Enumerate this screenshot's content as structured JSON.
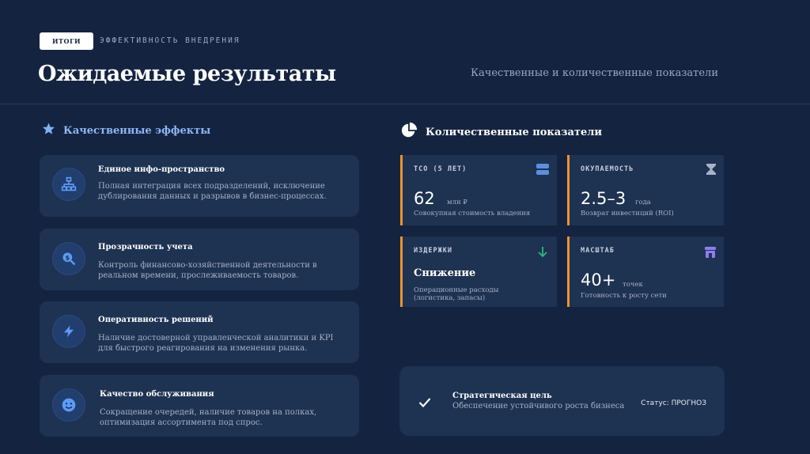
{
  "header": {
    "tag": "ИТОГИ",
    "eyebrow": "ЭФФЕКТИВНОСТЬ ВНЕДРЕНИЯ",
    "title": "Ожидаемые результаты",
    "subtitle": "Качественные и количественные показатели"
  },
  "qualitative": {
    "title": "Качественные эффекты",
    "icon": "star-icon",
    "items": [
      {
        "icon": "network-icon",
        "title": "Единое инфо-пространство",
        "text": "Полная интеграция всех подразделений, исключение дублирования данных и разрывов в бизнес-процессах."
      },
      {
        "icon": "search-dollar-icon",
        "title": "Прозрачность учета",
        "text": "Контроль финансово-хозяйственной деятельности в реальном времени, прослеживаемость товаров."
      },
      {
        "icon": "bolt-icon",
        "title": "Оперативность решений",
        "text": "Наличие достоверной управленческой аналитики и KPI для быстрого реагирования на изменения рынка."
      },
      {
        "icon": "smile-icon",
        "title": "Качество обслуживания",
        "text": "Сокращение очередей, наличие товаров на полках, оптимизация ассортимента под спрос."
      }
    ]
  },
  "quantitative": {
    "title": "Количественные показатели",
    "icon": "pie-chart-icon",
    "metrics": [
      {
        "label": "TCO (5 ЛЕТ)",
        "value": "62",
        "unit": "млн ₽",
        "sub": "Совокупная стоимость владения",
        "icon": "server-icon",
        "icon_color": "#5b8fe0"
      },
      {
        "label": "ОКУПАЕМОСТЬ",
        "value": "2.5–3",
        "unit": "года",
        "sub": "Возврат инвестиций (ROI)",
        "icon": "hourglass-icon",
        "icon_color": "#a8b4c6"
      },
      {
        "label": "ИЗДЕРЖКИ",
        "value": "Снижение",
        "unit": "",
        "sub": "Операционные расходы (логистика, запасы)",
        "icon": "arrow-down-icon",
        "icon_color": "#2fb67c"
      },
      {
        "label": "МАСШТАБ",
        "value": "40+",
        "unit": "точек",
        "sub": "Готовность к росту сети",
        "icon": "store-icon",
        "icon_color": "#8f7cf0"
      }
    ]
  },
  "goal": {
    "title": "Стратегическая цель",
    "text": "Обеспечение устойчивого роста бизнеса",
    "status": "Статус: ПРОГНОЗ",
    "icon": "check-icon"
  },
  "colors": {
    "background": "#142440",
    "card": "#1e3252",
    "accent": "#f0922f",
    "highlight": "#8fb6f5"
  }
}
